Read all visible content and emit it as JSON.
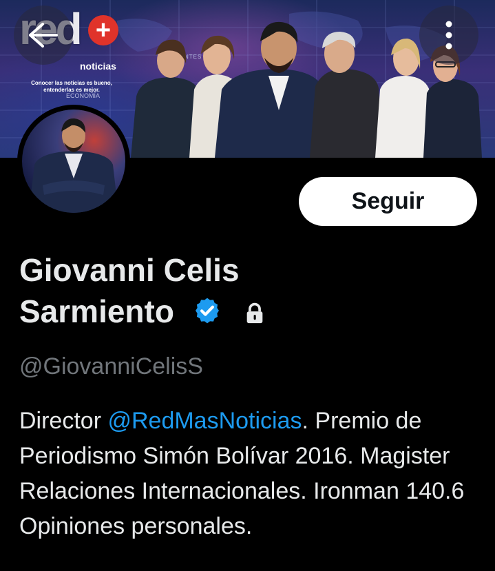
{
  "banner": {
    "brand_name": "red",
    "brand_plus": "+",
    "brand_noticias": "noticias",
    "brand_tagline": "Conocer las noticias es bueno, entenderlas es mejor.",
    "brand_section": "ECONOMÍA",
    "background_label": "NTES"
  },
  "icons": {
    "back": "arrow-left-icon",
    "more": "more-vertical-icon",
    "verified": "verified-badge-icon",
    "lock": "lock-icon"
  },
  "actions": {
    "follow_label": "Seguir"
  },
  "profile": {
    "name_line1": "Giovanni Celis",
    "name_line2": "Sarmiento",
    "handle": "@GiovanniCelisS",
    "bio": {
      "prefix": "Director ",
      "mention": "@RedMasNoticias",
      "suffix": ". Premio de Periodismo Simón Bolívar 2016. Magister Relaciones Internacionales. Ironman 140.6 Opiniones personales."
    }
  },
  "colors": {
    "background": "#000000",
    "text_primary": "#e7e9ea",
    "text_secondary": "#71767b",
    "link": "#1d9bf0",
    "verified": "#1d9bf0",
    "follow_bg": "#ffffff",
    "brand_accent": "#e0332a"
  }
}
